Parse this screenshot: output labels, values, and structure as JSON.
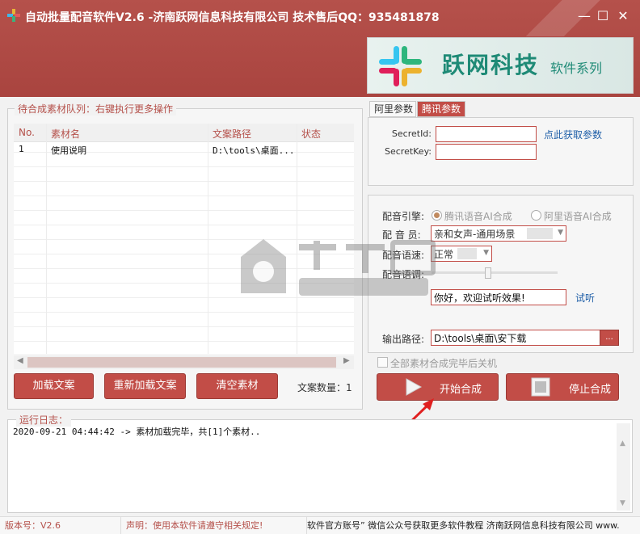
{
  "window": {
    "title": "自动批量配音软件V2.6 -济南跃网信息科技有限公司 技术售后QQ：935481878",
    "minimize_icon": "minimize-icon",
    "maximize_icon": "maximize-icon",
    "close_icon": "close-icon"
  },
  "brand": {
    "main": "跃网科技",
    "sub": "软件系列"
  },
  "queue": {
    "title": "待合成素材队列：右键执行更多操作",
    "columns": [
      "No.",
      "素材名",
      "文案路径",
      "状态"
    ],
    "rows": [
      {
        "no": "1",
        "name": "使用说明",
        "path": "D:\\tools\\桌面...",
        "status": ""
      }
    ],
    "buttons": {
      "load": "加载文案",
      "reload": "重新加载文案",
      "clear": "清空素材"
    },
    "count_label": "文案数量：1"
  },
  "tabs": [
    {
      "label": "阿里参数",
      "active": false
    },
    {
      "label": "腾讯参数",
      "active": true
    }
  ],
  "keys": {
    "secret_id_label": "SecretId:",
    "secret_id_value": "",
    "secret_key_label": "SecretKey:",
    "secret_key_value": "",
    "get_params_link": "点此获取参数"
  },
  "voice": {
    "engine_label": "配音引擎:",
    "engine_options": [
      {
        "label": "腾讯语音AI合成",
        "selected": true
      },
      {
        "label": "阿里语音AI合成",
        "selected": false
      }
    ],
    "voice_label": "配 音 员:",
    "voice_value": "亲和女声-通用场景",
    "speed_label": "配音语速:",
    "speed_value": "正常",
    "pitch_label": "配音语调:",
    "pitch_level": 0.45,
    "preview_text": "你好，欢迎试听效果!",
    "preview_link": "试听",
    "output_label": "输出路径:",
    "output_value": "D:\\tools\\桌面\\安下载",
    "browse_label": "...",
    "shutdown_label": "全部素材合成完毕后关机"
  },
  "actions": {
    "start": "开始合成",
    "stop": "停止合成"
  },
  "log": {
    "title": "运行日志：",
    "lines": [
      "2020-09-21 04:44:42 -> 素材加载完毕，共[1]个素材.."
    ]
  },
  "statusbar": {
    "version": "版本号：V2.6",
    "notice": "声明：使用本软件请遵守相关规定!",
    "marquee": "软件官方账号” 微信公众号获取更多软件教程 济南跃网信息科技有限公司 www."
  },
  "colors": {
    "accent": "#c24d47",
    "header": "#a9443f",
    "brand_green": "#1e8a76",
    "link": "#1f5fa8"
  }
}
